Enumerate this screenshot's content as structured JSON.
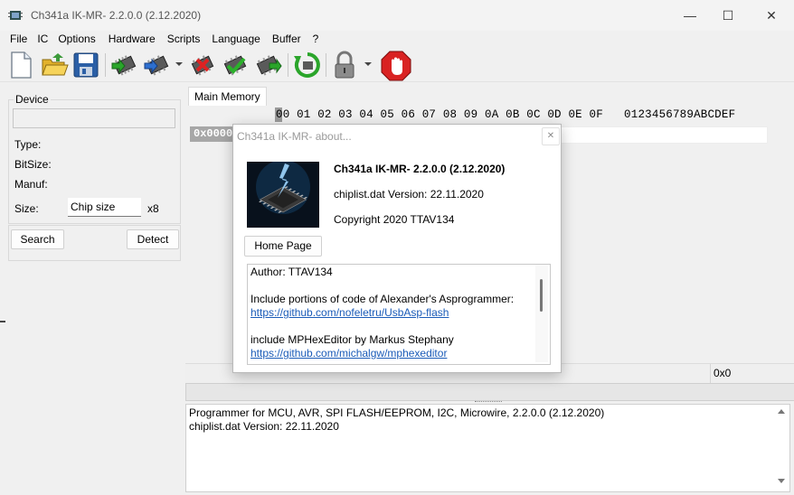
{
  "window": {
    "title": "Ch341a IK-MR- 2.2.0.0 (2.12.2020)",
    "controls": [
      "—",
      "☐",
      "✕"
    ]
  },
  "menu": [
    "File",
    "IC",
    "Options",
    "Hardware",
    "Scripts",
    "Language",
    "Buffer",
    "?"
  ],
  "toolbar": {
    "buttons": [
      "new-file",
      "open-folder",
      "save",
      "read-chip",
      "verify",
      "erase",
      "write",
      "blank-check",
      "auto",
      "lock",
      "stop"
    ]
  },
  "device": {
    "group_label": "Device",
    "type_label": "Type:",
    "bitsize_label": "BitSize:",
    "manuf_label": "Manuf:",
    "size_label": "Size:",
    "size_placeholder": "Chip size",
    "size_mult": "x8",
    "search_button": "Search",
    "detect_button": "Detect"
  },
  "hex": {
    "tab": "Main Memory",
    "header": "00 01 02 03 04 05 06 07 08 09 0A 0B 0C 0D 0E 0F   0123456789ABCDEF",
    "row_address": "0x0000",
    "status_address": "0x0"
  },
  "log": {
    "lines": [
      "Programmer for MCU, AVR, SPI FLASH/EEPROM, I2C, Microwire, 2.2.0.0 (2.12.2020)",
      "chiplist.dat Version: 22.11.2020"
    ]
  },
  "about": {
    "title": "Ch341a IK-MR- about...",
    "close": "✕",
    "app_name": "Ch341a IK-MR- 2.2.0.0 (2.12.2020)",
    "chiplist": "chiplist.dat Version: 22.11.2020",
    "copyright": "Copyright 2020 TTAV134",
    "home_button": "Home Page",
    "info": {
      "author": "Author: TTAV134",
      "include1": "Include portions of code of Alexander's Asprogrammer:",
      "link1": "https://github.com/nofeletru/UsbAsp-flash",
      "include2": "include MPHexEditor  by  Markus Stephany",
      "link2": "https://github.com/michalgw/mphexeditor"
    }
  }
}
